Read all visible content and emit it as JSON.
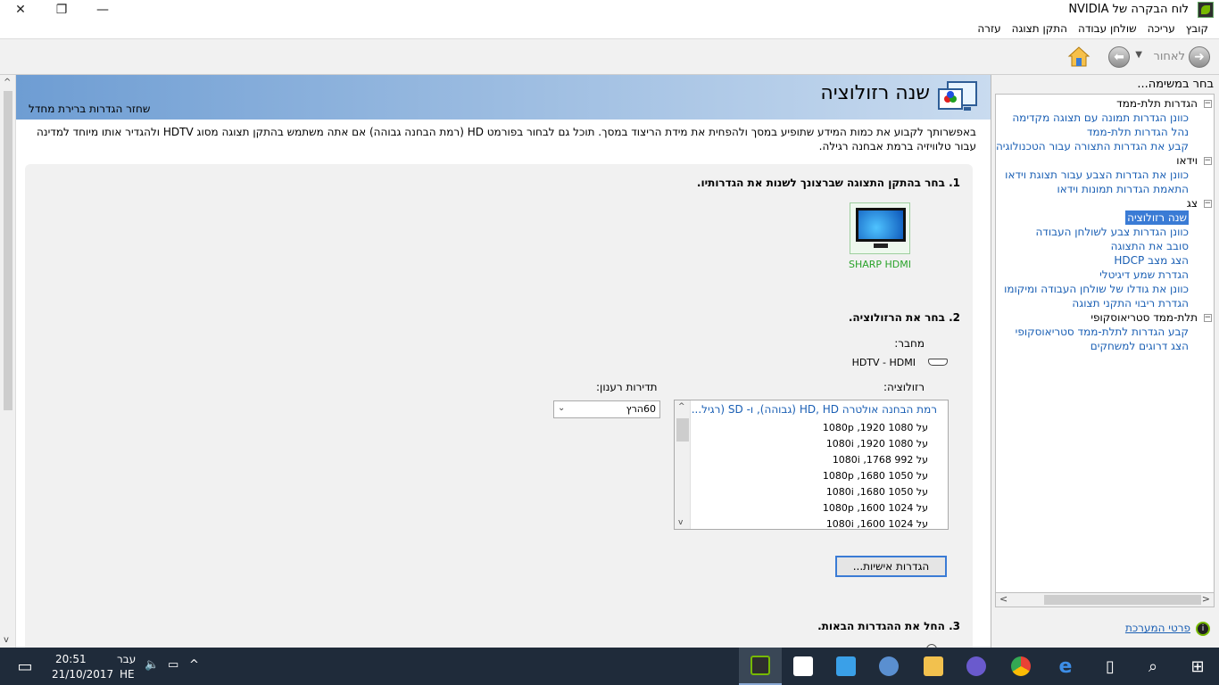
{
  "window": {
    "title": "לוח הבקרה של NVIDIA",
    "close_glyph": "✕",
    "maximize_glyph": "❐",
    "minimize_glyph": "—"
  },
  "menu": [
    "קובץ",
    "עריכה",
    "שולחן עבודה",
    "התקן תצוגה",
    "עזרה"
  ],
  "toolbar": {
    "back_label": "לאחור"
  },
  "page": {
    "title": "שנה רזולוציה",
    "restore_link": "שחזר הגדרות ברירת מחדל",
    "description": "באפשרותך לקבוע את כמות המידע שתופיע במסך ולהפחית את מידת הריצוד במסך. תוכל גם לבחור בפורמט HD (רמת הבחנה גבוהה) אם אתה משתמש בהתקן תצוגה מסוג HDTV ולהגדיר אותו מיוחד למדינה עבור טלוויזיה ברמת אבחנה רגילה.",
    "step1": "1. בחר בהתקן התצוגה שברצונך לשנות את הגדרותיו.",
    "display_name": "SHARP HDMI",
    "step2": "2. בחר את הרזולוציה.",
    "connector_label": "מחבר:",
    "connector_value": "HDTV - HDMI",
    "resolution_label": "רזולוציה:",
    "refresh_label": "תדירות רענון:",
    "refresh_value": "60הרץ",
    "resolution_header": "רמת הבחנה אולטרה HD, HD (גבוהה), ו- SD (רגיל...",
    "resolutions": [
      "1080p ,1920 על 1080",
      "1080i ,1920 על 1080",
      "1080i ,1768 על 992",
      "1080p ,1680 על 1050",
      "1080i ,1680 על 1050",
      "1080p ,1600 על 1024",
      "1080i ,1600 על 1024"
    ],
    "custom_button": "הגדרות אישיות...",
    "step3": "3. החל את ההגדרות הבאות."
  },
  "taskpane": {
    "title": "בחר במשימה...",
    "tree": [
      {
        "type": "cat",
        "label": "הגדרות תלת-ממד"
      },
      {
        "type": "link",
        "label": "כוונן הגדרות תמונה עם תצוגה מקדימה"
      },
      {
        "type": "link",
        "label": "נהל הגדרות תלת-ממד"
      },
      {
        "type": "link",
        "label": "קבע את הגדרות התצורה עבור הטכנולוגיה"
      },
      {
        "type": "cat",
        "label": "וידאו"
      },
      {
        "type": "link",
        "label": "כוונן את הגדרות הצבע עבור תצוגת וידאו"
      },
      {
        "type": "link",
        "label": "התאמת הגדרות תמונות וידאו"
      },
      {
        "type": "cat",
        "label": "צג"
      },
      {
        "type": "sel",
        "label": "שנה רזולוציה"
      },
      {
        "type": "link",
        "label": "כוונן הגדרות צבע לשולחן העבודה"
      },
      {
        "type": "link",
        "label": "סובב את התצוגה"
      },
      {
        "type": "link",
        "label": "הצג מצב HDCP"
      },
      {
        "type": "link",
        "label": "הגדרת שמע דיגיטלי"
      },
      {
        "type": "link",
        "label": "כוונן את גודלו של שולחן העבודה ומיקומו"
      },
      {
        "type": "link",
        "label": "הגדרת ריבוי התקני תצוגה"
      },
      {
        "type": "cat",
        "label": "תלת-ממד סטריאוסקופי"
      },
      {
        "type": "link",
        "label": "קבע הגדרות לתלת-ממד סטריאוסקופי"
      },
      {
        "type": "link",
        "label": "הצג דרוגים למשחקים"
      }
    ],
    "system_info": "פרטי המערכת"
  },
  "taskbar": {
    "time": "20:51",
    "date": "21/10/2017",
    "lang_1": "עבר",
    "lang_2": "HE"
  }
}
